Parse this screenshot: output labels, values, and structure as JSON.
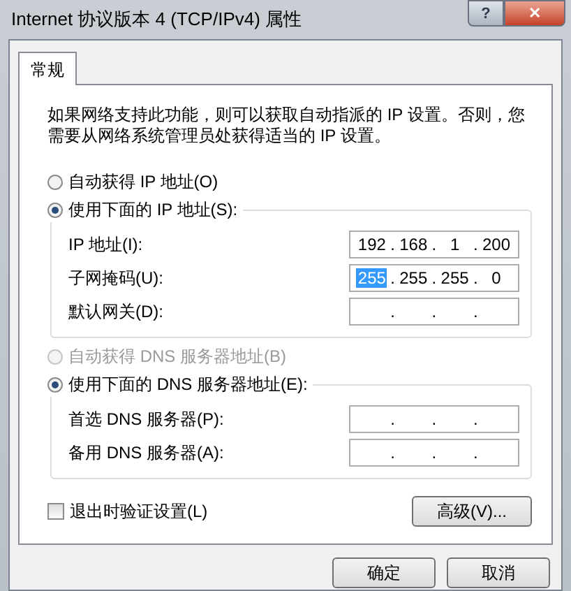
{
  "window": {
    "title": "Internet 协议版本 4 (TCP/IPv4) 属性",
    "help_button": "?",
    "close_button": "✕"
  },
  "tabs": [
    {
      "label": "常规",
      "selected": true
    }
  ],
  "description": "如果网络支持此功能，则可以获取自动指派的 IP 设置。否则，您需要从网络系统管理员处获得适当的 IP 设置。",
  "ip_section": {
    "options": [
      {
        "label": "自动获得 IP 地址(O)",
        "selected": false,
        "disabled": false
      },
      {
        "label": "使用下面的 IP 地址(S):",
        "selected": true,
        "disabled": false
      }
    ],
    "fields": [
      {
        "label": "IP 地址(I):",
        "dots": [
          ".",
          ".",
          "."
        ],
        "octets": [
          {
            "text": "192",
            "selected": false
          },
          {
            "text": "168",
            "selected": false
          },
          {
            "text": "1",
            "selected": false
          },
          {
            "text": "200",
            "selected": false
          }
        ]
      },
      {
        "label": "子网掩码(U):",
        "dots": [
          ".",
          ".",
          "."
        ],
        "octets": [
          {
            "text": "255",
            "selected": true
          },
          {
            "text": "255",
            "selected": false
          },
          {
            "text": "255",
            "selected": false
          },
          {
            "text": "0",
            "selected": false
          }
        ]
      },
      {
        "label": "默认网关(D):",
        "dots": [
          ".",
          ".",
          "."
        ]
      }
    ]
  },
  "dns_section": {
    "options": [
      {
        "label": "自动获得 DNS 服务器地址(B)",
        "selected": false,
        "disabled": true
      },
      {
        "label": "使用下面的 DNS 服务器地址(E):",
        "selected": true,
        "disabled": false
      }
    ],
    "fields": [
      {
        "label": "首选 DNS 服务器(P):",
        "dots": [
          ".",
          ".",
          "."
        ]
      },
      {
        "label": "备用 DNS 服务器(A):",
        "dots": [
          ".",
          ".",
          "."
        ]
      }
    ]
  },
  "validate_checkbox": {
    "label": "退出时验证设置(L)",
    "checked": false
  },
  "advanced_button": "高级(V)...",
  "buttons": [
    "确定",
    "取消"
  ]
}
